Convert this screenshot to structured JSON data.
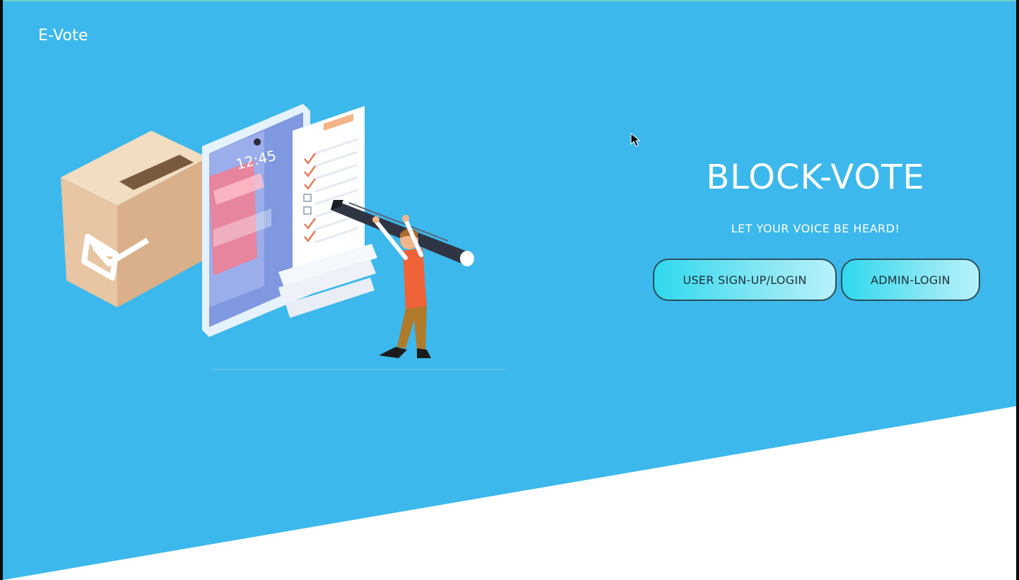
{
  "header": {
    "brand": "E-Vote"
  },
  "hero": {
    "title": "BLOCK-VOTE",
    "tagline": "LET YOUR VOICE BE HEARD!",
    "illustration": {
      "phone_time": "12:45"
    }
  },
  "actions": {
    "user_button_label": "USER SIGN-UP/LOGIN",
    "admin_button_label": "ADMIN-LOGIN"
  },
  "colors": {
    "background": "#3cb8ec",
    "bottom_wedge": "#ffffff",
    "button_gradient_start": "#2fd8ee",
    "button_gradient_end": "#b6f1fa"
  }
}
